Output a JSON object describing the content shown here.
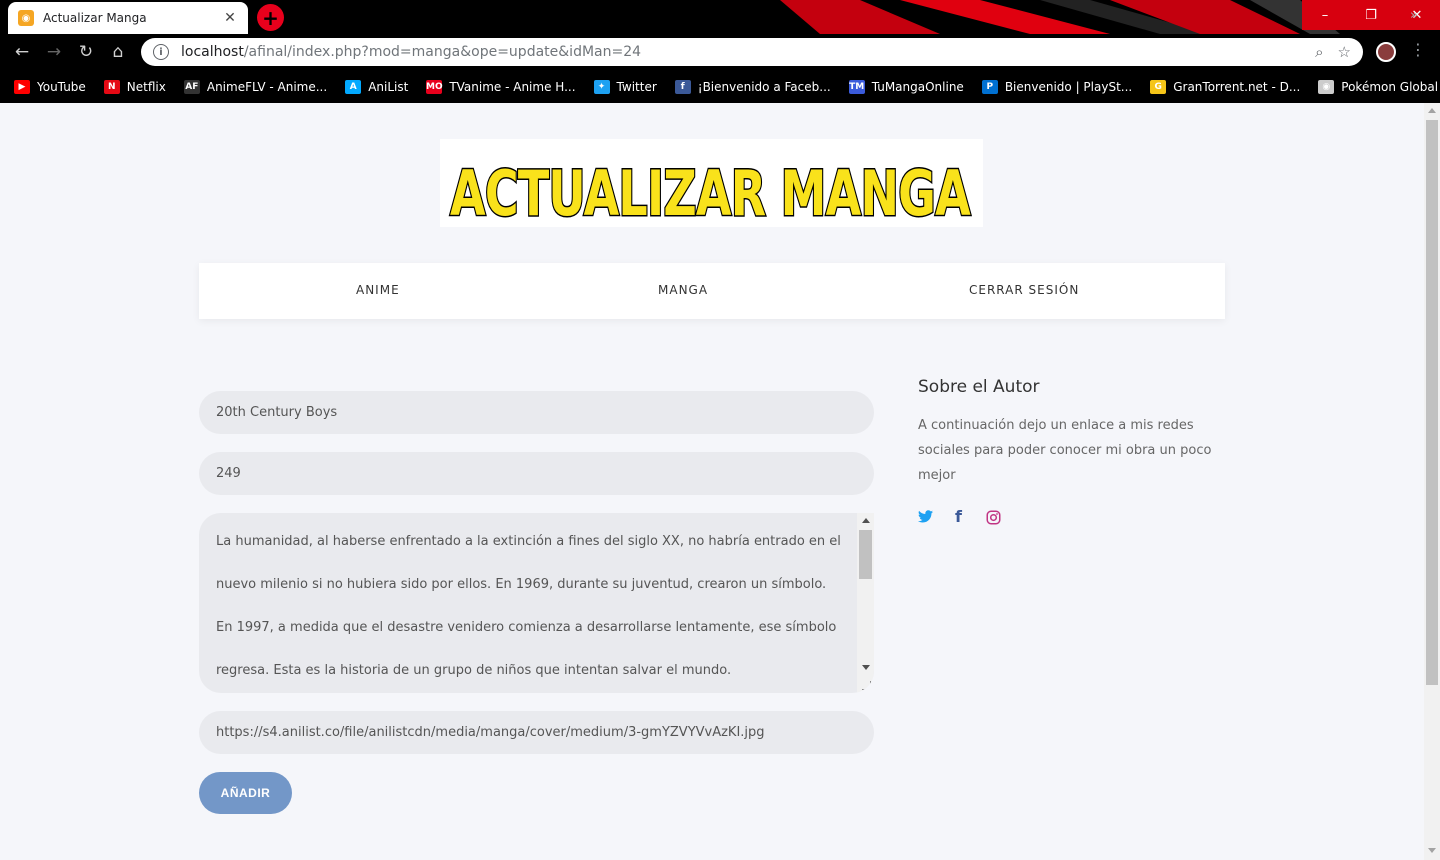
{
  "browser": {
    "tab_title": "Actualizar Manga",
    "tab_close": "✕",
    "new_tab": "+",
    "url_host": "localhost",
    "url_path": "/afinal/index.php?mod=manga&ope=update&idMan=24",
    "window_controls": {
      "minimize": "–",
      "maximize": "❐",
      "close": "✕"
    },
    "bookmarks": [
      {
        "label": "YouTube",
        "icon": "youtube-icon",
        "color": "#ff0000",
        "glyph": "▶"
      },
      {
        "label": "Netflix",
        "icon": "netflix-icon",
        "color": "#e50914",
        "glyph": "N"
      },
      {
        "label": "AnimeFLV - Anime...",
        "icon": "animeflv-icon",
        "color": "#333333",
        "glyph": "AF"
      },
      {
        "label": "AniList",
        "icon": "anilist-icon",
        "color": "#02a9ff",
        "glyph": "A"
      },
      {
        "label": "TVanime - Anime H...",
        "icon": "tvanime-icon",
        "color": "#e8001c",
        "glyph": "MO"
      },
      {
        "label": "Twitter",
        "icon": "twitter-icon",
        "color": "#1da1f2",
        "glyph": "✦"
      },
      {
        "label": "¡Bienvenido a Faceb...",
        "icon": "facebook-icon",
        "color": "#3b5998",
        "glyph": "f"
      },
      {
        "label": "TuMangaOnline",
        "icon": "tumangaonline-icon",
        "color": "#3b5bdb",
        "glyph": "TM"
      },
      {
        "label": "Bienvenido | PlaySt...",
        "icon": "playstation-icon",
        "color": "#0070d1",
        "glyph": "P"
      },
      {
        "label": "GranTorrent.net - D...",
        "icon": "grantorrent-icon",
        "color": "#f5c518",
        "glyph": "G"
      },
      {
        "label": "Pokémon Global Link",
        "icon": "pokemon-icon",
        "color": "#cccccc",
        "glyph": "◉"
      }
    ]
  },
  "page": {
    "banner_text": "ACTUALIZAR MANGA",
    "nav": [
      "ANIME",
      "MANGA",
      "CERRAR SESIÓN"
    ],
    "form": {
      "title_value": "20th Century Boys",
      "chapters_value": "249",
      "synopsis_value": "La humanidad, al haberse enfrentado a la extinción a fines del siglo XX, no habría entrado en el nuevo milenio si no hubiera sido por ellos. En 1969, durante su juventud, crearon un símbolo. En 1997, a medida que el desastre venidero comienza a desarrollarse lentamente, ese símbolo regresa. Esta es la historia de un grupo de niños que intentan salvar el mundo.",
      "image_value": "https://s4.anilist.co/file/anilistcdn/media/manga/cover/medium/3-gmYZVYVvAzKI.jpg",
      "submit_label": "AÑADIR"
    },
    "aside": {
      "title": "Sobre el Autor",
      "text": "A continuación dejo un enlace a mis redes sociales para poder conocer mi obra un poco mejor",
      "social": [
        {
          "name": "twitter-icon",
          "glyph": "🐦",
          "color": "#1da1f2"
        },
        {
          "name": "facebook-icon",
          "glyph": "f",
          "color": "#3b5998"
        },
        {
          "name": "instagram-icon",
          "glyph": "◎",
          "color": "#c13584"
        }
      ]
    }
  },
  "colors": {
    "page_bg": "#f5f6fa",
    "field_bg": "#e9eaee",
    "button_bg": "#7397c8",
    "banner_yellow": "#f9e21b"
  }
}
